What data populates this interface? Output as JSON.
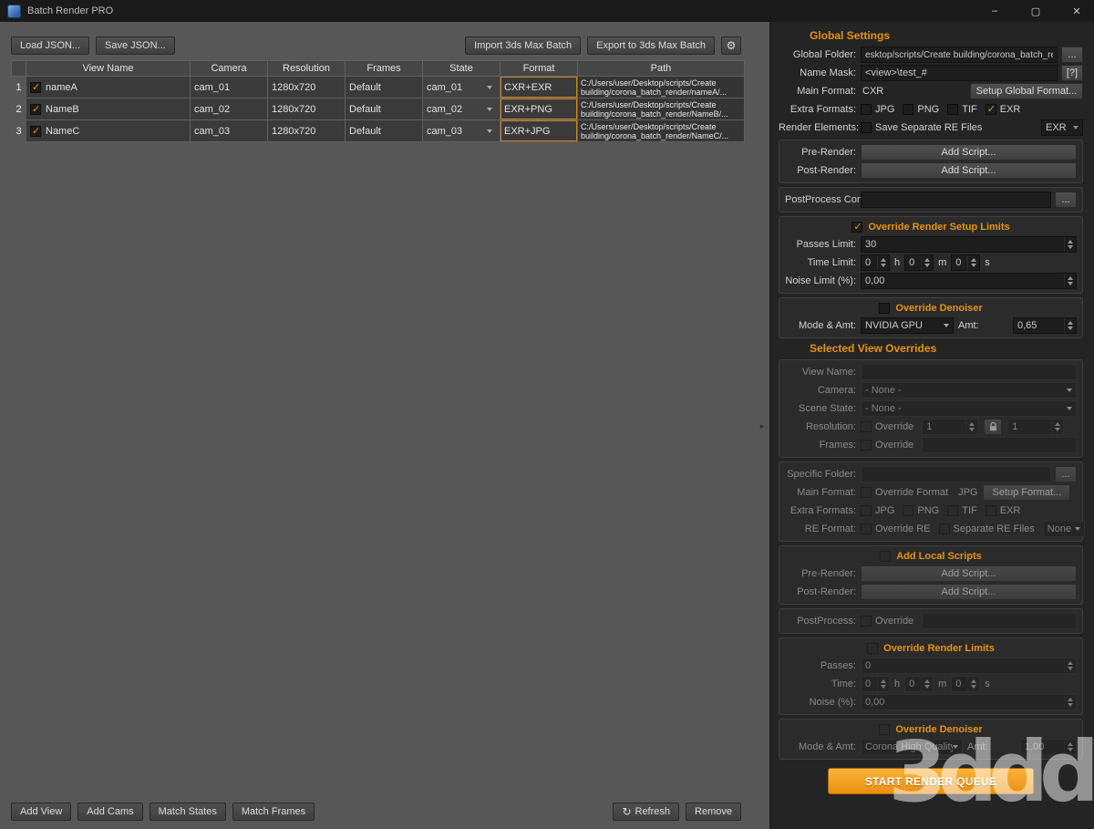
{
  "window": {
    "title": "Batch Render PRO"
  },
  "icons": {
    "gear": "⚙",
    "refresh": "↻",
    "minimize": "–",
    "maximize": "▢",
    "close": "✕",
    "splitter": "▸"
  },
  "toolbar": {
    "load_json": "Load JSON...",
    "save_json": "Save JSON...",
    "import_batch": "Import 3ds Max Batch",
    "export_batch": "Export to 3ds Max Batch"
  },
  "table": {
    "headers": {
      "view_name": "View Name",
      "camera": "Camera",
      "resolution": "Resolution",
      "frames": "Frames",
      "state": "State",
      "format": "Format",
      "path": "Path"
    },
    "rows": [
      {
        "num": "1",
        "view_name": "nameA",
        "camera": "cam_01",
        "resolution": "1280x720",
        "frames": "Default",
        "state": "cam_01",
        "format": "CXR+EXR",
        "path": "C:/Users/user/Desktop/scripts/Create building/corona_batch_render/nameA/..."
      },
      {
        "num": "2",
        "view_name": "NameB",
        "camera": "cam_02",
        "resolution": "1280x720",
        "frames": "Default",
        "state": "cam_02",
        "format": "EXR+PNG",
        "path": "C:/Users/user/Desktop/scripts/Create building/corona_batch_render/NameB/..."
      },
      {
        "num": "3",
        "view_name": "NameC",
        "camera": "cam_03",
        "resolution": "1280x720",
        "frames": "Default",
        "state": "cam_03",
        "format": "EXR+JPG",
        "path": "C:/Users/user/Desktop/scripts/Create building/corona_batch_render/NameC/..."
      }
    ]
  },
  "bottom_bar": {
    "add_view": "Add View",
    "add_cams": "Add Cams",
    "match_states": "Match States",
    "match_frames": "Match Frames",
    "refresh": "Refresh",
    "remove": "Remove"
  },
  "global_settings": {
    "title": "Global Settings",
    "global_folder": {
      "label": "Global Folder:",
      "value": "esktop/scripts/Create building/corona_batch_render",
      "browse": "..."
    },
    "name_mask": {
      "label": "Name Mask:",
      "value": "<view>\\test_#",
      "help": "[?]"
    },
    "main_format": {
      "label": "Main Format:",
      "value": "CXR",
      "setup": "Setup Global Format..."
    },
    "extra_formats": {
      "label": "Extra Formats:",
      "jpg": "JPG",
      "png": "PNG",
      "tif": "TIF",
      "exr": "EXR"
    },
    "render_elements": {
      "label": "Render Elements:",
      "save_separate": "Save Separate RE Files",
      "format": "EXR"
    },
    "pre_render": {
      "label": "Pre-Render:",
      "button": "Add Script..."
    },
    "post_render": {
      "label": "Post-Render:",
      "button": "Add Script..."
    },
    "postprocess_conf": {
      "label": "PostProcess Conf:",
      "browse": "..."
    },
    "override_limits": {
      "title": "Override Render Setup Limits",
      "passes_limit": {
        "label": "Passes Limit:",
        "value": "30"
      },
      "time_limit": {
        "label": "Time Limit:",
        "h": "0",
        "h_unit": "h",
        "m": "0",
        "m_unit": "m",
        "s": "0",
        "s_unit": "s"
      },
      "noise_limit": {
        "label": "Noise Limit (%):",
        "value": "0,00"
      }
    },
    "override_denoiser": {
      "title": "Override Denoiser",
      "mode_amt": {
        "label": "Mode & Amt:",
        "mode": "NVIDIA GPU",
        "amt_label": "Amt:",
        "amt": "0,65"
      }
    }
  },
  "view_overrides": {
    "title": "Selected View Overrides",
    "view_name": {
      "label": "View Name:"
    },
    "camera": {
      "label": "Camera:",
      "value": "- None -"
    },
    "scene_state": {
      "label": "Scene State:",
      "value": "- None -"
    },
    "resolution": {
      "label": "Resolution:",
      "override": "Override",
      "width": "1",
      "height": "1"
    },
    "frames": {
      "label": "Frames:",
      "override": "Override"
    },
    "specific_folder": {
      "label": "Specific Folder:",
      "browse": "..."
    },
    "main_format": {
      "label": "Main Format:",
      "override": "Override Format",
      "value": "JPG",
      "setup": "Setup Format..."
    },
    "extra_formats": {
      "label": "Extra Formats:",
      "jpg": "JPG",
      "png": "PNG",
      "tif": "TIF",
      "exr": "EXR"
    },
    "re_format": {
      "label": "RE Format:",
      "override": "Override RE",
      "separate": "Separate RE Files",
      "value": "None"
    },
    "local_scripts": {
      "title": "Add Local Scripts",
      "pre_render": {
        "label": "Pre-Render:",
        "button": "Add Script..."
      },
      "post_render": {
        "label": "Post-Render:",
        "button": "Add Script..."
      }
    },
    "postprocess": {
      "label": "PostProcess:",
      "override": "Override"
    },
    "override_limits": {
      "title": "Override Render Limits",
      "passes": {
        "label": "Passes:",
        "value": "0"
      },
      "time": {
        "label": "Time:",
        "h": "0",
        "h_unit": "h",
        "m": "0",
        "m_unit": "m",
        "s": "0",
        "s_unit": "s"
      },
      "noise": {
        "label": "Noise (%):",
        "value": "0,00"
      }
    },
    "override_denoiser": {
      "title": "Override Denoiser",
      "mode_amt": {
        "label": "Mode & Amt:",
        "mode": "Corona High Quality",
        "amt_label": "Amt:",
        "amt": "1,00"
      }
    }
  },
  "start_button": "START RENDER QUEUE",
  "watermark": "3ddd",
  "colors": {
    "accent": "#e8930c"
  }
}
